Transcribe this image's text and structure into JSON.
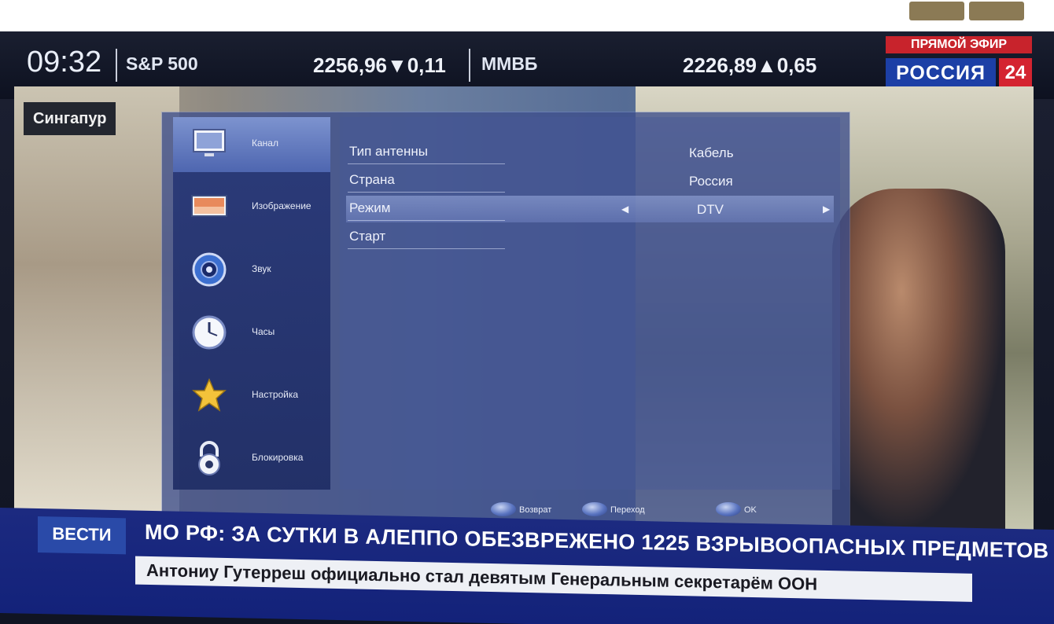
{
  "ticker": {
    "time": "09:32",
    "index1_name": "S&P 500",
    "index1_value": "2256,96▼0,11",
    "index2_name": "ММВБ",
    "index2_value": "2226,89▲0,65"
  },
  "channel": {
    "live_label": "ПРЯМОЙ ЭФИР",
    "name": "РОССИЯ",
    "number": "24"
  },
  "location": "Сингапур",
  "menu": {
    "sidebar": [
      {
        "label": "Канал",
        "icon": "channel-icon",
        "selected": true
      },
      {
        "label": "Изображение",
        "icon": "picture-icon",
        "selected": false
      },
      {
        "label": "Звук",
        "icon": "sound-icon",
        "selected": false
      },
      {
        "label": "Часы",
        "icon": "clock-icon",
        "selected": false
      },
      {
        "label": "Настройка",
        "icon": "star-icon",
        "selected": false
      },
      {
        "label": "Блокировка",
        "icon": "lock-icon",
        "selected": false
      }
    ],
    "rows": [
      {
        "label": "Тип антенны",
        "value": "Кабель"
      },
      {
        "label": "Страна",
        "value": "Россия"
      },
      {
        "label": "Режим",
        "value": "DTV"
      },
      {
        "label": "Старт",
        "value": ""
      }
    ],
    "footer": {
      "back": "Возврат",
      "navigate": "Переход",
      "ok": "OK"
    }
  },
  "news": {
    "tag": "ВЕСТИ",
    "headline": "МО РФ: ЗА СУТКИ В АЛЕППО ОБЕЗВРЕЖЕНО 1225 ВЗРЫВООПАСНЫХ ПРЕДМЕТОВ",
    "sub": "Антониу Гутерреш официально стал девятым Генеральным секретарём ООН"
  }
}
